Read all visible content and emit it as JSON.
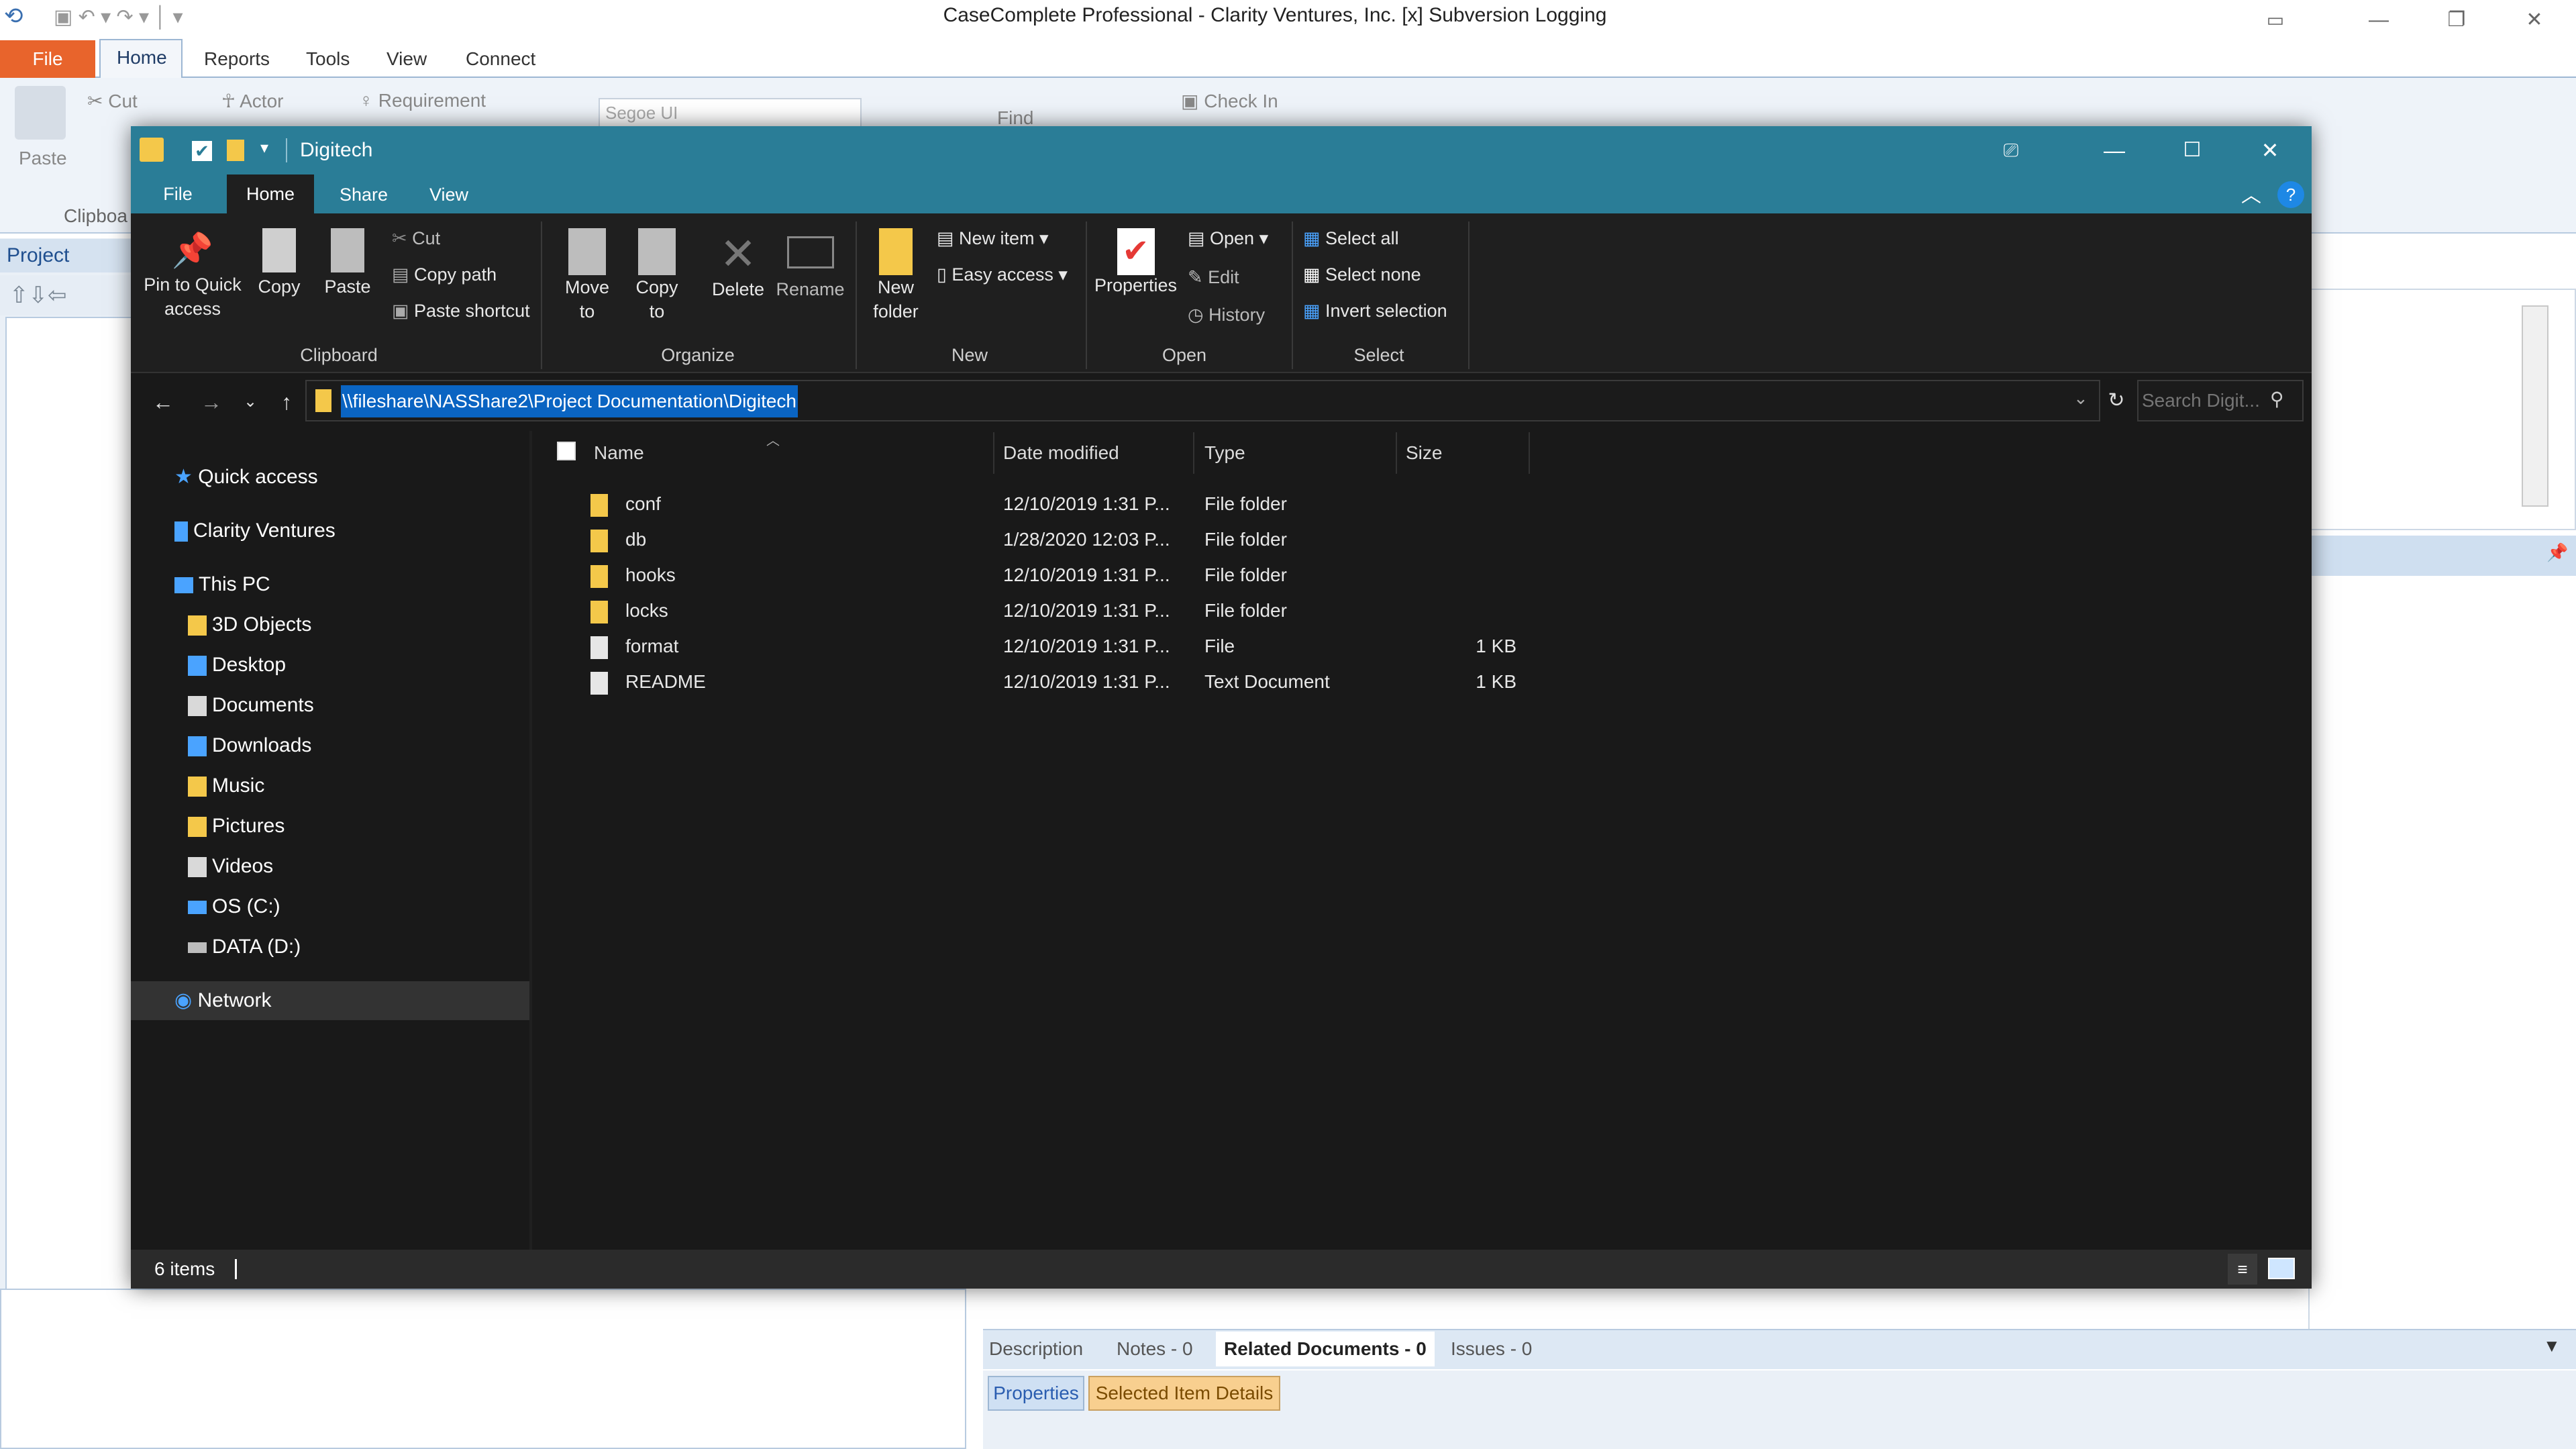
{
  "background_app": {
    "title": "CaseComplete Professional - Clarity Ventures, Inc. [x] Subversion Logging",
    "tabs": [
      "File",
      "Home",
      "Reports",
      "Tools",
      "View",
      "Connect"
    ],
    "ribbon": {
      "paste": "Paste",
      "cut": "Cut",
      "actor": "Actor",
      "requirement": "Requirement",
      "font": "Segoe UI",
      "find": "Find",
      "check_in": "Check In",
      "clipboard_group": "Clipboa"
    },
    "left_panel_title": "Project Browse",
    "bottom_tabs": [
      "Description",
      "Notes - 0",
      "Related Documents - 0",
      "Issues - 0"
    ],
    "bottom_buttons": [
      "Properties",
      "Selected Item Details"
    ],
    "colors": {
      "file_tab": "#e8642c",
      "accent": "#9db7d3"
    }
  },
  "explorer": {
    "title": "Digitech",
    "tabs": [
      "File",
      "Home",
      "Share",
      "View"
    ],
    "ribbon": {
      "clipboard": {
        "pin": "Pin to Quick access",
        "copy": "Copy",
        "paste": "Paste",
        "cut": "Cut",
        "copy_path": "Copy path",
        "paste_shortcut": "Paste shortcut",
        "label": "Clipboard"
      },
      "organize": {
        "move_to": "Move to",
        "copy_to": "Copy to",
        "delete": "Delete",
        "rename": "Rename",
        "label": "Organize"
      },
      "new": {
        "new_folder": "New folder",
        "new_item": "New item",
        "easy_access": "Easy access",
        "label": "New"
      },
      "open": {
        "properties": "Properties",
        "open": "Open",
        "edit": "Edit",
        "history": "History",
        "label": "Open"
      },
      "select": {
        "select_all": "Select all",
        "select_none": "Select none",
        "invert": "Invert selection",
        "label": "Select"
      }
    },
    "address": "\\\\fileshare\\NASShare2\\Project Documentation\\Digitech",
    "search_placeholder": "Search Digit...",
    "nav": {
      "quick_access": "Quick access",
      "clarity": "Clarity Ventures",
      "this_pc": "This PC",
      "items": [
        "3D Objects",
        "Desktop",
        "Documents",
        "Downloads",
        "Music",
        "Pictures",
        "Videos",
        "OS (C:)",
        "DATA (D:)"
      ],
      "network": "Network"
    },
    "columns": {
      "name": "Name",
      "date": "Date modified",
      "type": "Type",
      "size": "Size"
    },
    "files": [
      {
        "name": "conf",
        "date": "12/10/2019 1:31 P...",
        "type": "File folder",
        "size": "",
        "kind": "folder"
      },
      {
        "name": "db",
        "date": "1/28/2020 12:03 P...",
        "type": "File folder",
        "size": "",
        "kind": "folder"
      },
      {
        "name": "hooks",
        "date": "12/10/2019 1:31 P...",
        "type": "File folder",
        "size": "",
        "kind": "folder"
      },
      {
        "name": "locks",
        "date": "12/10/2019 1:31 P...",
        "type": "File folder",
        "size": "",
        "kind": "folder"
      },
      {
        "name": "format",
        "date": "12/10/2019 1:31 P...",
        "type": "File",
        "size": "1 KB",
        "kind": "file"
      },
      {
        "name": "README",
        "date": "12/10/2019 1:31 P...",
        "type": "Text Document",
        "size": "1 KB",
        "kind": "file"
      }
    ],
    "status": "6 items",
    "colors": {
      "title_bar": "#2a7d97",
      "background": "#191919",
      "selection": "#0a64c2",
      "folder": "#f4c84a"
    }
  }
}
